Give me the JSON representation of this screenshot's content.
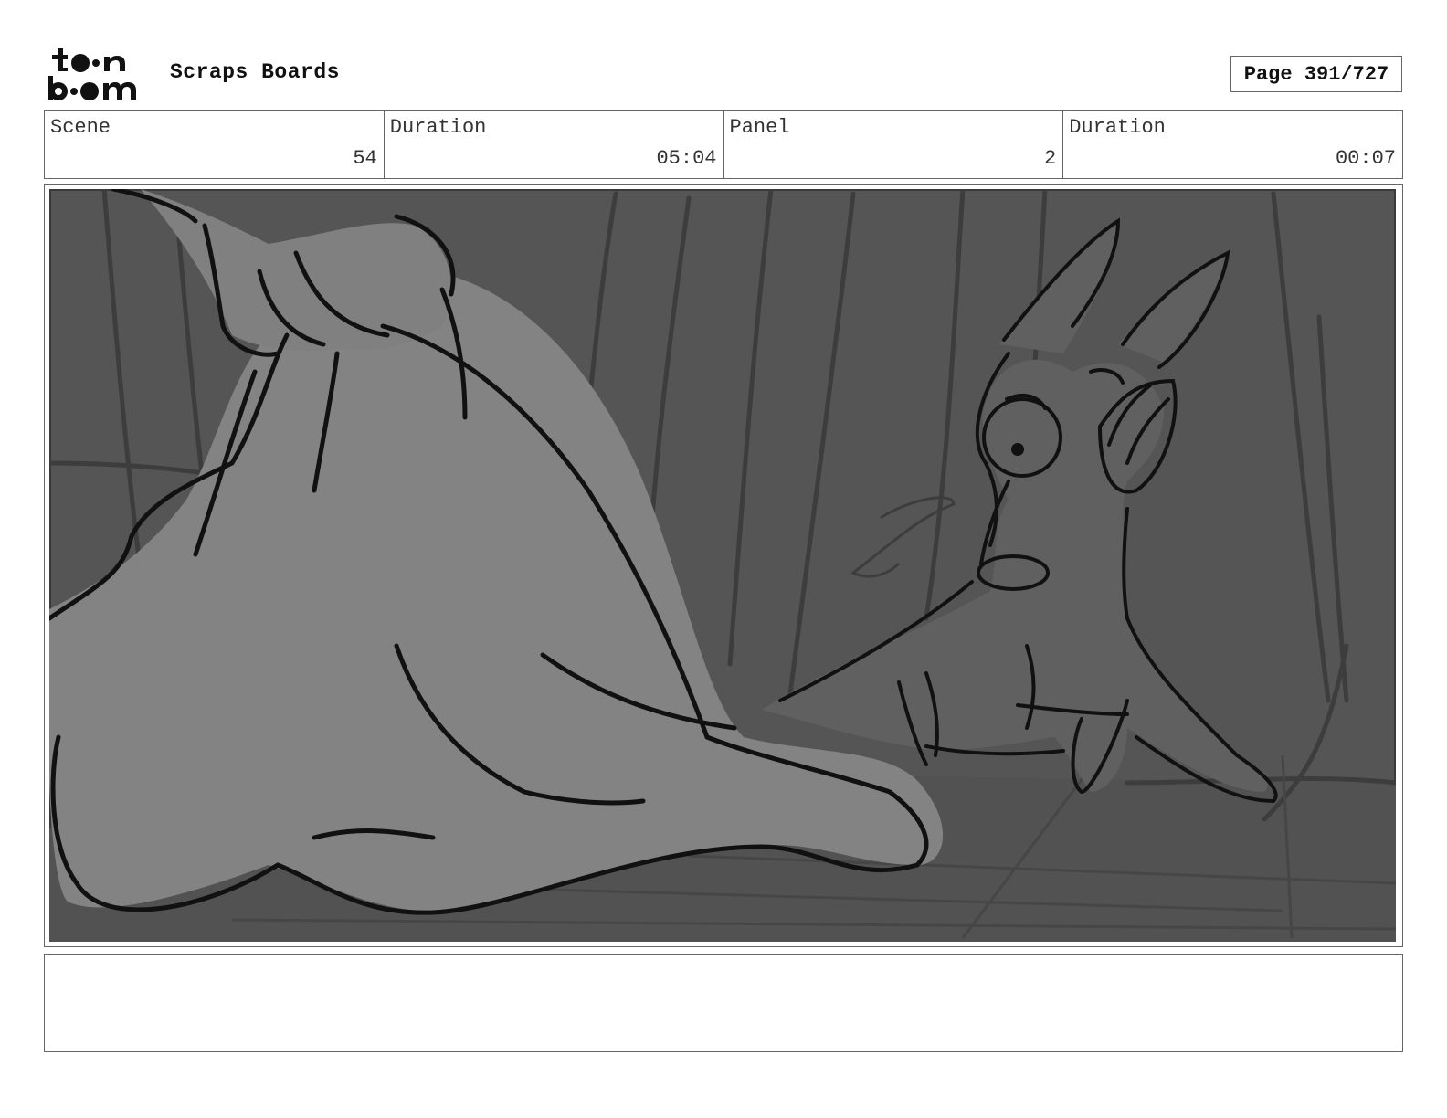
{
  "header": {
    "logo_text": "toon boom",
    "title": "Scraps Boards",
    "page_label": "Page 391/727"
  },
  "info": {
    "scene_label": "Scene",
    "scene_value": "54",
    "scene_duration_label": "Duration",
    "scene_duration_value": "05:04",
    "panel_label": "Panel",
    "panel_value": "2",
    "panel_duration_label": "Duration",
    "panel_duration_value": "00:07"
  },
  "notes": {
    "text": ""
  }
}
